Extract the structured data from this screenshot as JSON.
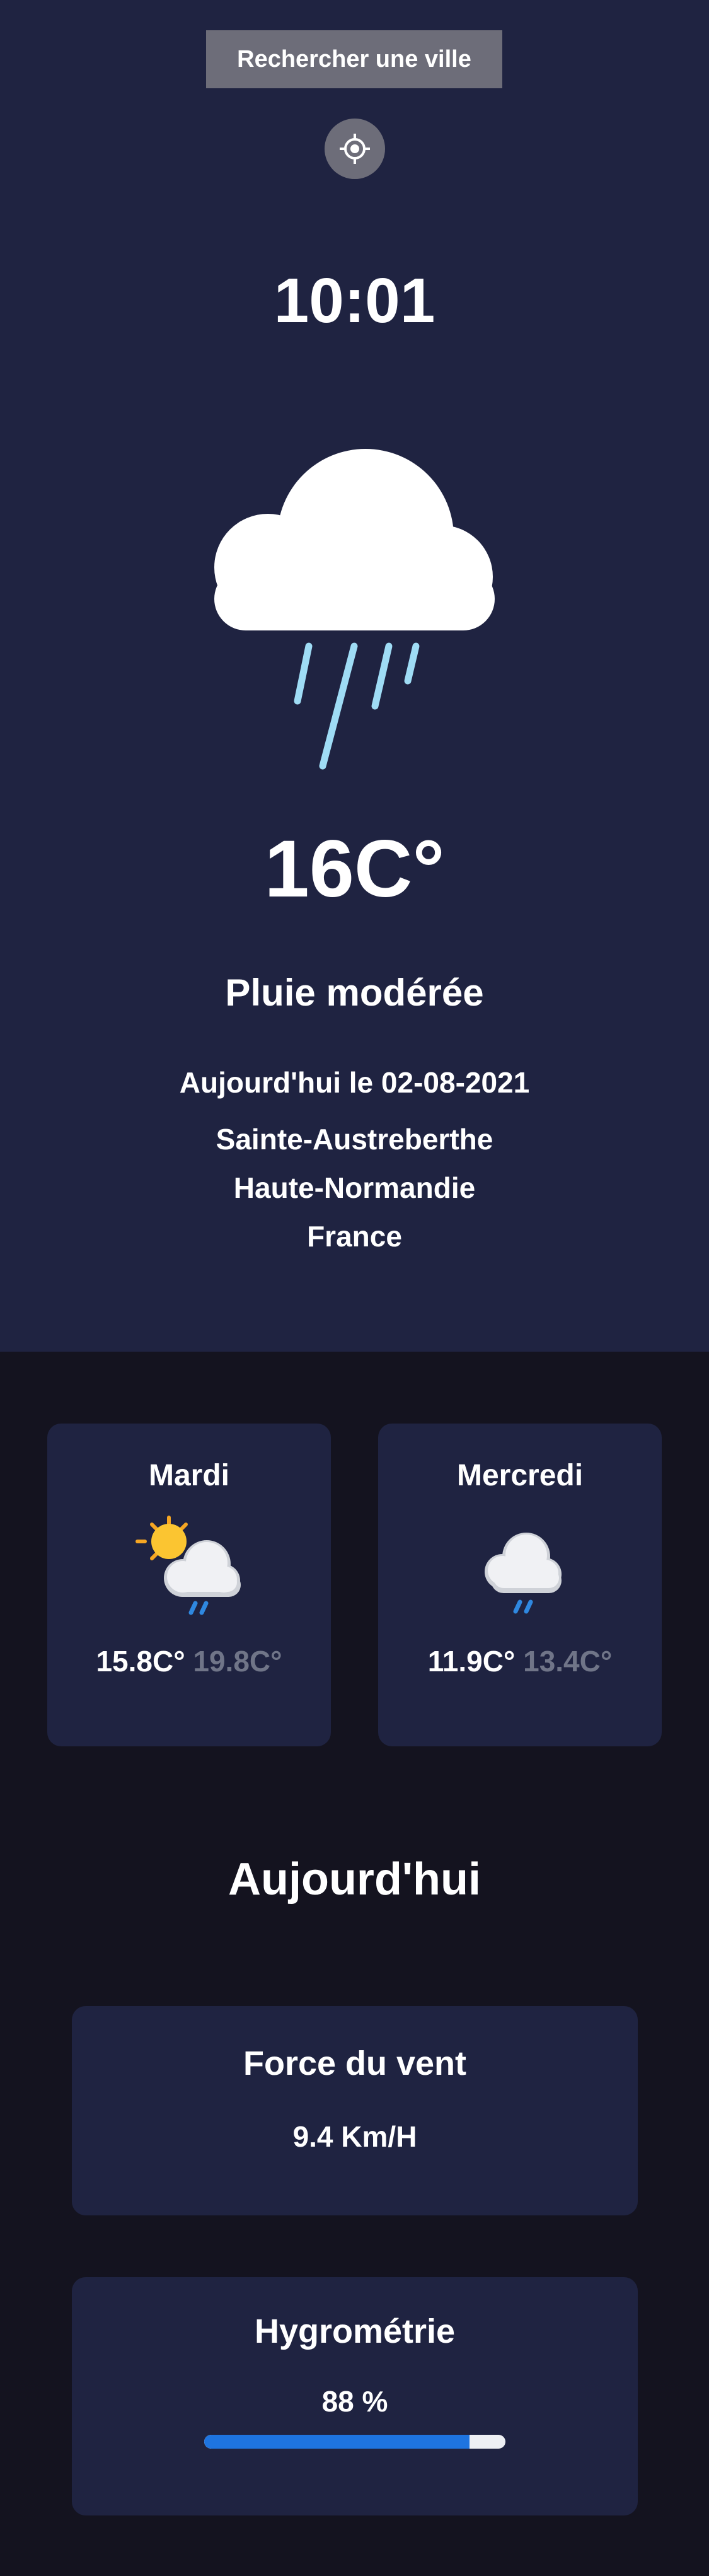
{
  "header": {
    "search_label": "Rechercher une ville",
    "locate_icon": "crosshair-location-icon"
  },
  "current": {
    "time": "10:01",
    "icon": "rain-cloud-icon",
    "temperature": "16C°",
    "condition": "Pluie modérée",
    "date": "Aujourd'hui le 02-08-2021",
    "location": {
      "city": "Sainte-Austreberthe",
      "region": "Haute-Normandie",
      "country": "France"
    }
  },
  "forecast": [
    {
      "day": "Mardi",
      "icon": "sun-cloud-rain-icon",
      "min": "15.8C°",
      "max": "19.8C°"
    },
    {
      "day": "Mercredi",
      "icon": "cloud-rain-icon",
      "min": "11.9C°",
      "max": "13.4C°"
    }
  ],
  "today": {
    "title": "Aujourd'hui",
    "wind": {
      "label": "Force du vent",
      "value": "9.4 Km/H"
    },
    "humidity": {
      "label": "Hygrométrie",
      "value": "88 %",
      "percent": 88
    }
  },
  "colors": {
    "hero_bg": "#1f2341",
    "page_bg": "#14131f",
    "card_bg": "#1f2341",
    "button_bg": "#6d6d79",
    "progress_fill": "#1e74e0",
    "muted_text": "#707588"
  }
}
